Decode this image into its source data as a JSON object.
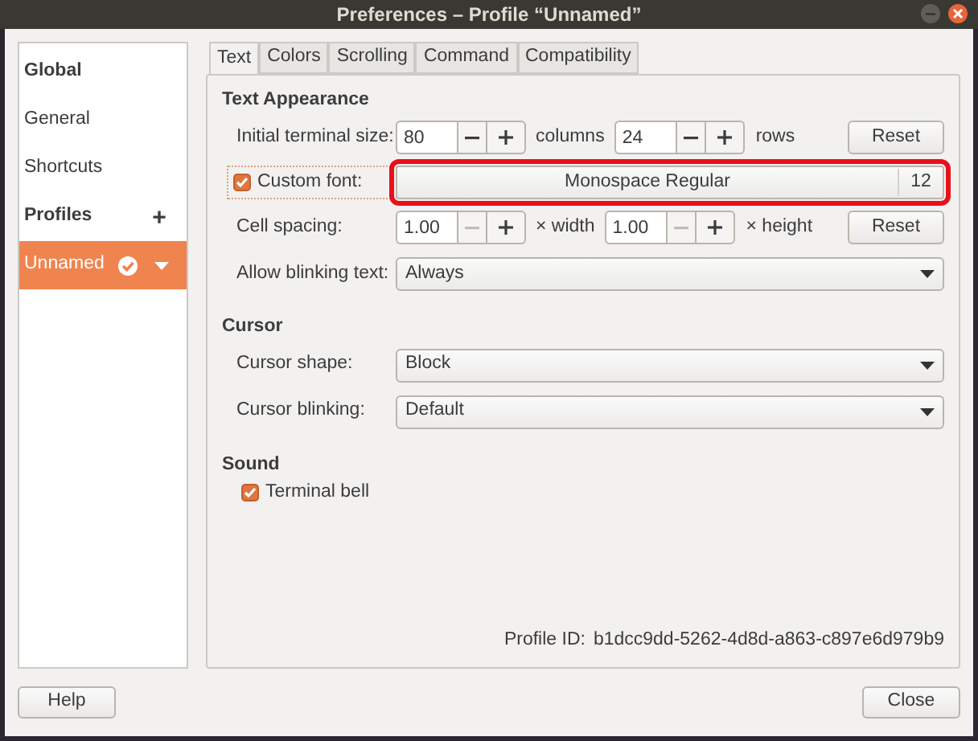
{
  "window": {
    "title": "Preferences – Profile “Unnamed”"
  },
  "sidebar": {
    "items": [
      {
        "kind": "heading",
        "label": "Global",
        "selected": false
      },
      {
        "kind": "item",
        "label": "General",
        "selected": false
      },
      {
        "kind": "item",
        "label": "Shortcuts",
        "selected": false
      },
      {
        "kind": "heading-add",
        "label": "Profiles",
        "add": "+",
        "selected": false
      },
      {
        "kind": "profile",
        "label": "Unnamed",
        "default": true,
        "selected": true
      }
    ]
  },
  "tabs": [
    {
      "label": "Text",
      "selected": true
    },
    {
      "label": "Colors",
      "selected": false
    },
    {
      "label": "Scrolling",
      "selected": false
    },
    {
      "label": "Command",
      "selected": false
    },
    {
      "label": "Compatibility",
      "selected": false
    }
  ],
  "text_appearance": {
    "title": "Text Appearance",
    "initial_size": {
      "label": "Initial terminal size:",
      "columns": {
        "value": "80",
        "minus_disabled": false
      },
      "columns_unit": "columns",
      "rows": {
        "value": "24",
        "minus_disabled": false
      },
      "rows_unit": "rows",
      "reset": "Reset"
    },
    "custom_font": {
      "label": "Custom font:",
      "checked": true,
      "font": "Monospace Regular",
      "size": "12",
      "highlighted": true
    },
    "cell_spacing": {
      "label": "Cell spacing:",
      "width": {
        "value": "1.00",
        "minus_disabled": true
      },
      "width_unit": "× width",
      "height": {
        "value": "1.00",
        "minus_disabled": true
      },
      "height_unit": "× height",
      "reset": "Reset"
    },
    "blinking": {
      "label": "Allow blinking text:",
      "value": "Always"
    }
  },
  "cursor": {
    "title": "Cursor",
    "shape": {
      "label": "Cursor shape:",
      "value": "Block"
    },
    "blinking": {
      "label": "Cursor blinking:",
      "value": "Default"
    }
  },
  "sound": {
    "title": "Sound",
    "terminal_bell": {
      "label": "Terminal bell",
      "checked": true
    }
  },
  "profile_id": {
    "label": "Profile ID:",
    "value": "b1dcc9dd-5262-4d8d-a863-c897e6d979b9"
  },
  "buttons": {
    "help": "Help",
    "close": "Close"
  }
}
